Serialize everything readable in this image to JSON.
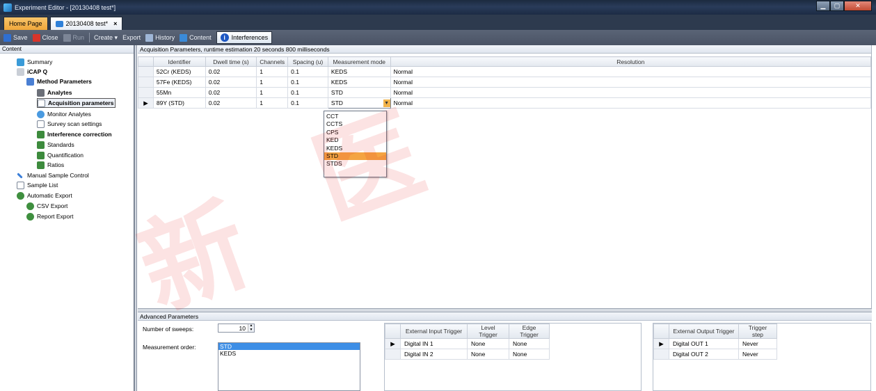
{
  "window": {
    "title": "Experiment Editor - [20130408 test*]"
  },
  "tabs": [
    {
      "label": "Home Page"
    },
    {
      "label": "20130408 test*",
      "close": "×"
    }
  ],
  "toolbar": {
    "save": "Save",
    "close": "Close",
    "run": "Run",
    "create": "Create ▾",
    "export": "Export",
    "history": "History",
    "content": "Content",
    "interferences": "Interferences"
  },
  "sidebar": {
    "header": "Content",
    "items": [
      {
        "label": "Summary"
      },
      {
        "label": "iCAP Q"
      },
      {
        "label": "Method Parameters"
      },
      {
        "label": "Analytes"
      },
      {
        "label": "Acquisition parameters"
      },
      {
        "label": "Monitor Analytes"
      },
      {
        "label": "Survey scan settings"
      },
      {
        "label": "Interference correction"
      },
      {
        "label": "Standards"
      },
      {
        "label": "Quantification"
      },
      {
        "label": "Ratios"
      },
      {
        "label": "Manual Sample Control"
      },
      {
        "label": "Sample List"
      },
      {
        "label": "Automatic Export"
      },
      {
        "label": "CSV Export"
      },
      {
        "label": "Report Export"
      }
    ]
  },
  "acquisition": {
    "header": "Acquisition Parameters, runtime estimation 20 seconds 800 milliseconds",
    "columns": [
      "Identifier",
      "Dwell time (s)",
      "Channels",
      "Spacing (u)",
      "Measurement mode",
      "Resolution"
    ],
    "rows": [
      [
        "52Cr (KEDS)",
        "0.02",
        "1",
        "0.1",
        "KEDS",
        "Normal"
      ],
      [
        "57Fe (KEDS)",
        "0.02",
        "1",
        "0.1",
        "KEDS",
        "Normal"
      ],
      [
        "55Mn",
        "0.02",
        "1",
        "0.1",
        "STD",
        "Normal"
      ],
      [
        "89Y (STD)",
        "0.02",
        "1",
        "0.1",
        "STD",
        "Normal"
      ]
    ],
    "current_row_marker": "▶",
    "dropdown_options": [
      "CCT",
      "CCTS",
      "CPS",
      "KED",
      "KEDS",
      "STD",
      "STDS"
    ],
    "dropdown_selected": "STD"
  },
  "advanced": {
    "header": "Advanced Parameters",
    "sweeps_label": "Number of sweeps:",
    "sweeps_value": "10",
    "order_label": "Measurement order:",
    "order_items": [
      "STD",
      "KEDS"
    ],
    "input_trigger": {
      "columns": [
        "External Input Trigger",
        "Level Trigger",
        "Edge Trigger"
      ],
      "rows": [
        [
          "Digital IN 1",
          "None",
          "None"
        ],
        [
          "Digital IN 2",
          "None",
          "None"
        ]
      ]
    },
    "output_trigger": {
      "columns": [
        "External Output Trigger",
        "Trigger step"
      ],
      "rows": [
        [
          "Digital OUT 1",
          "Never"
        ],
        [
          "Digital OUT 2",
          "Never"
        ]
      ]
    }
  },
  "colors": {
    "accent": "#f4a442",
    "titlebar": "#1b2a3f",
    "selection": "#3d8ee6"
  }
}
